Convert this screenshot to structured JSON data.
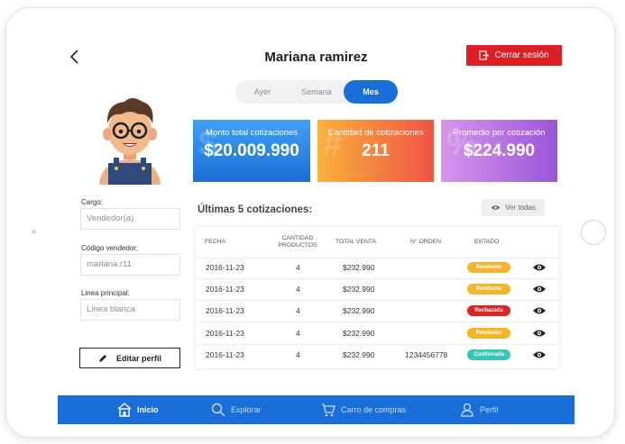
{
  "header": {
    "title": "Mariana ramirez",
    "logout_label": "Cerrar sesión"
  },
  "period_tabs": [
    {
      "label": "Ayer",
      "active": false
    },
    {
      "label": "Semana",
      "active": false
    },
    {
      "label": "Mes",
      "active": true
    }
  ],
  "profile": {
    "cargo_label": "Cargo:",
    "cargo_value": "Vendedor(a)",
    "codigo_label": "Código vendedor:",
    "codigo_value": "mariana.r11",
    "linea_label": "Linea principal:",
    "linea_value": "Linea blanca",
    "edit_label": "Editar perfil"
  },
  "stats": [
    {
      "label": "Monto total cotizaciones",
      "value": "$20.009.990",
      "glyph": "$"
    },
    {
      "label": "Cantidad de cotizaciones",
      "value": "211",
      "glyph": "#"
    },
    {
      "label": "Promedio por cotización",
      "value": "$224.990",
      "glyph": "%"
    }
  ],
  "quotes": {
    "title": "Últimas 5 cotizaciones:",
    "view_all_label": "Ver todas",
    "headers": {
      "fecha": "FECHA",
      "cantidad": "CANTIDAD PRODUCTOS",
      "total": "TOTAL VENTA",
      "orden": "N° ORDEN",
      "estado": "ESTADO"
    },
    "rows": [
      {
        "fecha": "2016-11-23",
        "cantidad": "4",
        "total": "$232.990",
        "orden": "",
        "estado": "Pendiente"
      },
      {
        "fecha": "2016-11-23",
        "cantidad": "4",
        "total": "$232.990",
        "orden": "",
        "estado": "Pendiente"
      },
      {
        "fecha": "2016-11-23",
        "cantidad": "4",
        "total": "$232.990",
        "orden": "",
        "estado": "Rechazada"
      },
      {
        "fecha": "2016-11-23",
        "cantidad": "4",
        "total": "$232.990",
        "orden": "",
        "estado": "Pendiente"
      },
      {
        "fecha": "2016-11-23",
        "cantidad": "4",
        "total": "$232.990",
        "orden": "1234456778",
        "estado": "Confirmada"
      }
    ]
  },
  "status_colors": {
    "Pendiente": "#f4b52b",
    "Rechazada": "#d62828",
    "Confirmada": "#35c9b4"
  },
  "nav": [
    {
      "label": "Inicio",
      "icon": "home-icon",
      "active": true
    },
    {
      "label": "Explorar",
      "icon": "search-icon",
      "active": false
    },
    {
      "label": "Carro de compras",
      "icon": "cart-icon",
      "active": false
    },
    {
      "label": "Perfil",
      "icon": "user-icon",
      "active": false
    }
  ]
}
